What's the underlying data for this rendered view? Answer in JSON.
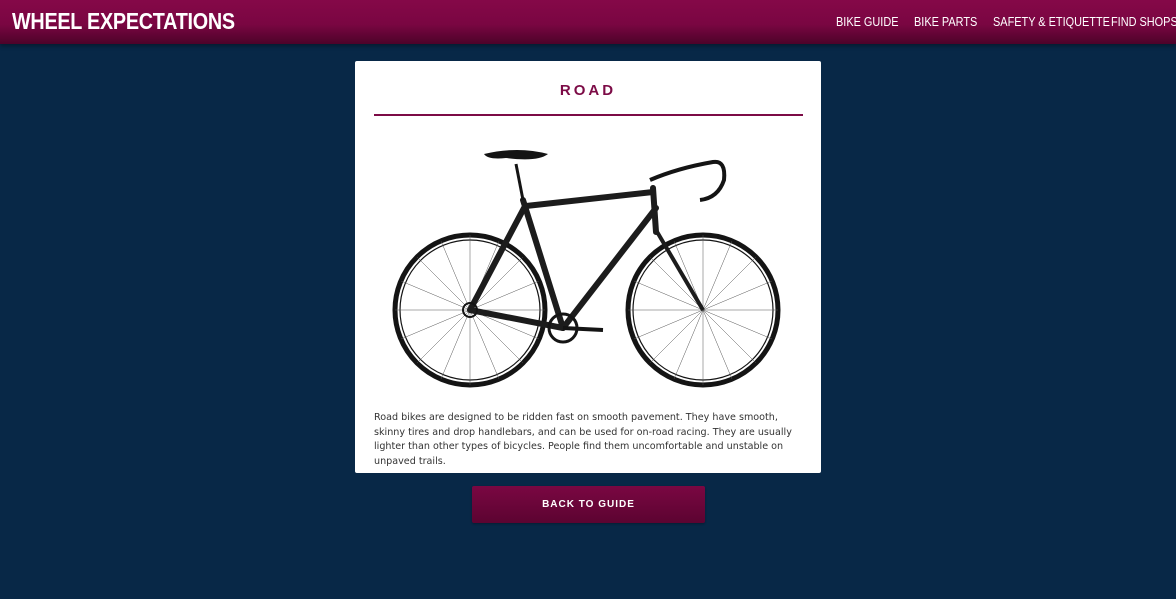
{
  "brand": {
    "name": "WHEEL EXPECTATIONS"
  },
  "nav": {
    "items": [
      {
        "label": "BIKE GUIDE"
      },
      {
        "label": "BIKE PARTS"
      },
      {
        "label": "SAFETY & ETIQUETTE"
      },
      {
        "label": "FIND SHOPS"
      }
    ]
  },
  "card": {
    "title": "ROAD",
    "image_alt": "Road bike",
    "description": "Road bikes are designed to be ridden fast on smooth pavement. They have smooth, skinny tires and drop handlebars, and can be used for on-road racing. They are usually lighter than other types of bicycles. People find them uncomfortable and unstable on unpaved trails."
  },
  "actions": {
    "back_label": "BACK TO GUIDE"
  },
  "colors": {
    "page_bg": "#082847",
    "brand": "#7c0b46",
    "card_bg": "#ffffff"
  }
}
